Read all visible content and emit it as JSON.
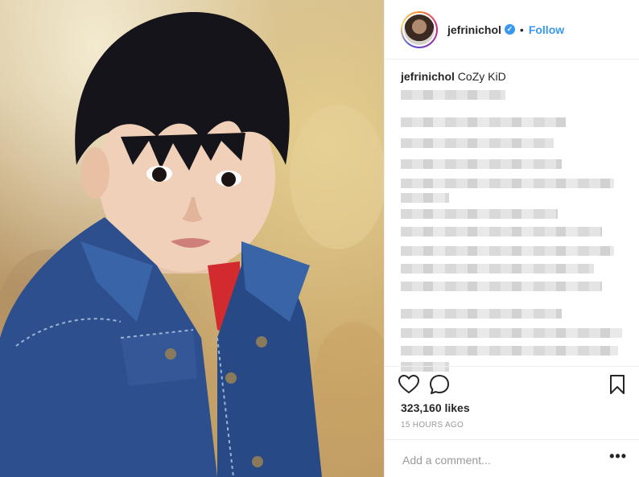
{
  "post": {
    "username": "jefrinichol",
    "verified": true,
    "separator": "•",
    "follow_label": "Follow",
    "caption_text": "CoZy KiD",
    "likes": "323,160 likes",
    "timestamp": "15 HOURS AGO",
    "comment_placeholder": "Add a comment...",
    "more_label": "•••"
  },
  "icons": {
    "avatar": "profile-avatar",
    "verified": "verified-badge-icon",
    "like": "heart-icon",
    "comment": "comment-bubble-icon",
    "save": "bookmark-icon",
    "more": "more-options-icon"
  },
  "colors": {
    "accent": "#3897f0",
    "text": "#262626",
    "muted": "#999999",
    "border": "#efefef"
  }
}
